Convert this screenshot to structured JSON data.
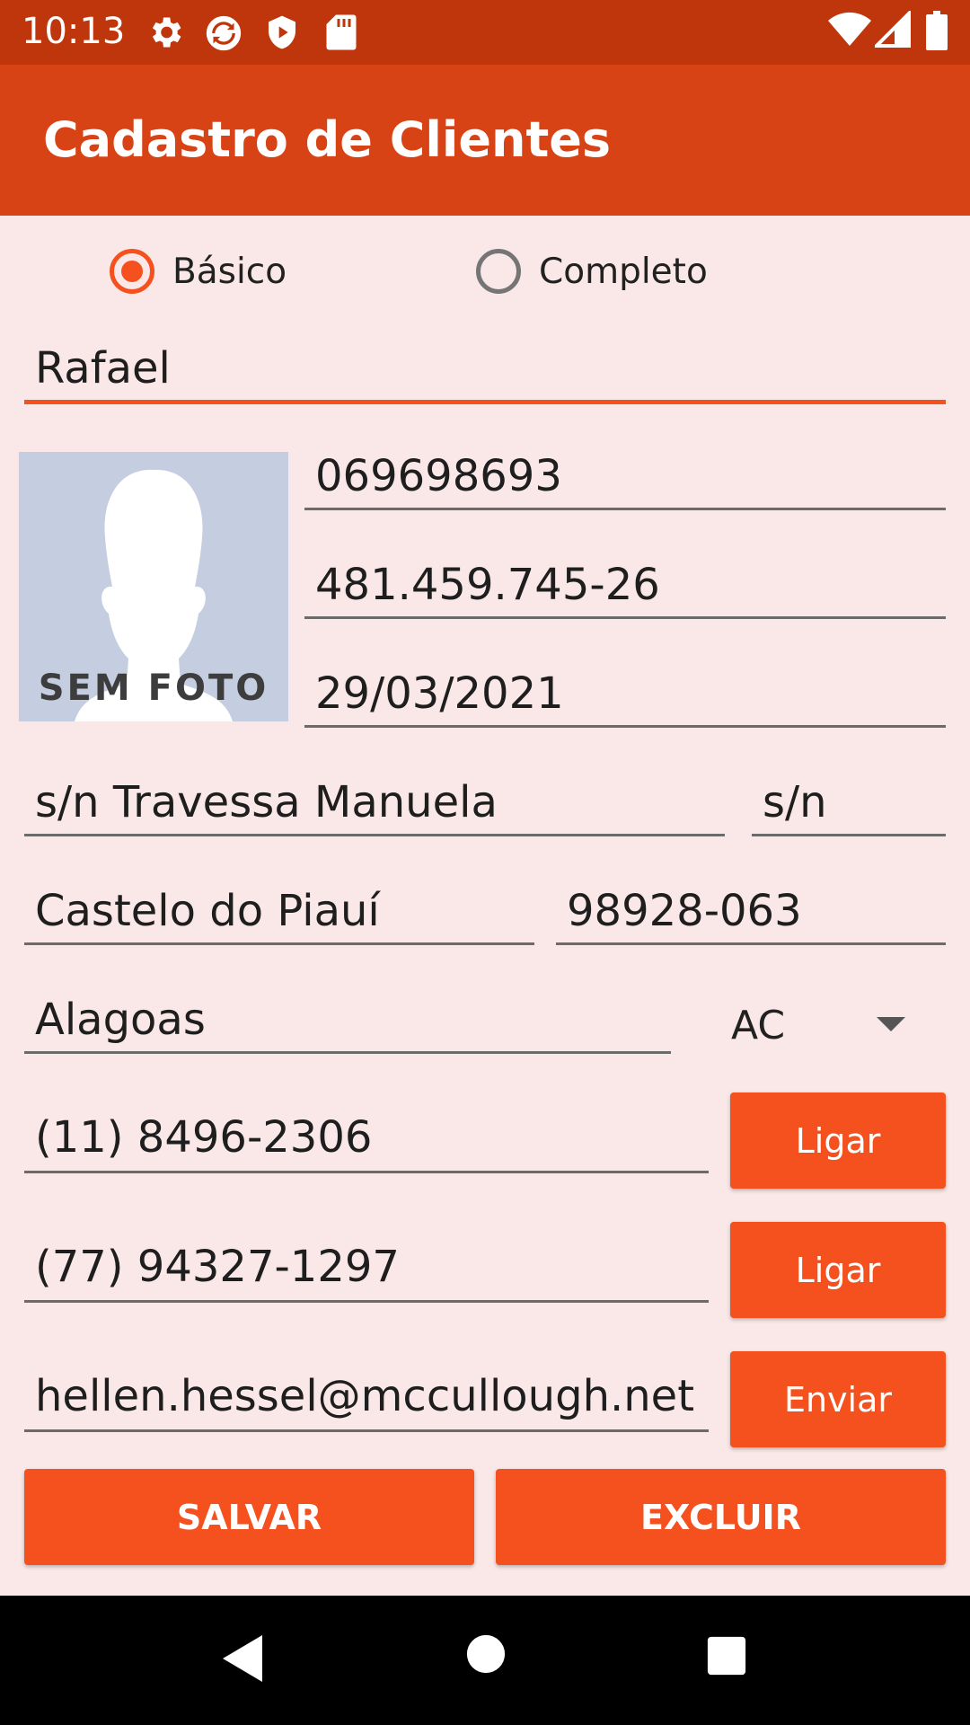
{
  "status_bar": {
    "time": "10:13",
    "left_icons": [
      "gear-icon",
      "sync-icon",
      "shield-play-icon",
      "sd-card-icon"
    ],
    "right_icons": [
      "wifi-icon",
      "signal-icon",
      "battery-icon"
    ]
  },
  "app_bar": {
    "title": "Cadastro de Clientes"
  },
  "form": {
    "mode_options": [
      {
        "label": "Básico",
        "checked": true
      },
      {
        "label": "Completo",
        "checked": false
      }
    ],
    "name": "Rafael",
    "photo_caption": "SEM FOTO",
    "rg": "069698693",
    "cpf": "481.459.745-26",
    "birth_date": "29/03/2021",
    "street": "s/n Travessa Manuela",
    "number": "s/n",
    "city": "Castelo do Piauí",
    "cep": "98928-063",
    "state_name": "Alagoas",
    "state_uf": "AC",
    "phone1": "(11) 8496-2306",
    "phone2": "(77) 94327-1297",
    "email": "hellen.hessel@mccullough.net"
  },
  "buttons": {
    "call1": "Ligar",
    "call2": "Ligar",
    "send": "Enviar",
    "save": "SALVAR",
    "delete": "EXCLUIR"
  },
  "colors": {
    "status_bar": "#bf360c",
    "app_bar": "#d84315",
    "accent": "#f4511e",
    "background": "#f9e8e7"
  }
}
